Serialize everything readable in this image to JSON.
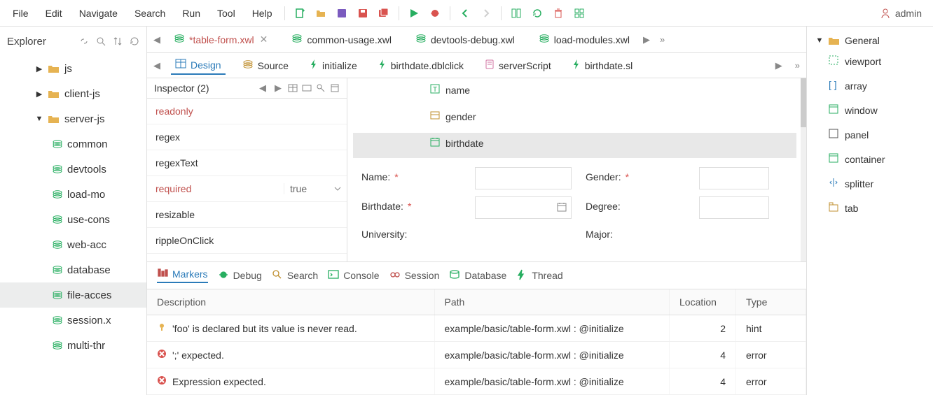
{
  "menu": {
    "file": "File",
    "edit": "Edit",
    "navigate": "Navigate",
    "search": "Search",
    "run": "Run",
    "tool": "Tool",
    "help": "Help"
  },
  "user": "admin",
  "explorer": {
    "title": "Explorer",
    "tree": [
      {
        "label": "js",
        "type": "folder",
        "depth": 1,
        "caret": "▶"
      },
      {
        "label": "client-js",
        "type": "folder",
        "depth": 1,
        "caret": "▶"
      },
      {
        "label": "server-js",
        "type": "folder",
        "depth": 1,
        "caret": "▼",
        "expanded": true
      },
      {
        "label": "common",
        "type": "file",
        "depth": 2
      },
      {
        "label": "devtools",
        "type": "file",
        "depth": 2
      },
      {
        "label": "load-mo",
        "type": "file",
        "depth": 2
      },
      {
        "label": "use-cons",
        "type": "file",
        "depth": 2
      },
      {
        "label": "web-acc",
        "type": "file",
        "depth": 2
      },
      {
        "label": "database",
        "type": "file",
        "depth": 2
      },
      {
        "label": "file-acces",
        "type": "file",
        "depth": 2,
        "selected": true
      },
      {
        "label": "session.x",
        "type": "file",
        "depth": 2
      },
      {
        "label": "multi-thr",
        "type": "file",
        "depth": 2
      }
    ]
  },
  "fileTabs": [
    {
      "label": "*table-form.xwl",
      "active": true,
      "closable": true
    },
    {
      "label": "common-usage.xwl"
    },
    {
      "label": "devtools-debug.xwl"
    },
    {
      "label": "load-modules.xwl"
    }
  ],
  "subTabs": [
    {
      "label": "Design",
      "icon": "grid",
      "active": true
    },
    {
      "label": "Source",
      "icon": "layers"
    },
    {
      "label": "initialize",
      "icon": "bolt"
    },
    {
      "label": "birthdate.dblclick",
      "icon": "bolt"
    },
    {
      "label": "serverScript",
      "icon": "script"
    },
    {
      "label": "birthdate.sl",
      "icon": "bolt"
    }
  ],
  "inspector": {
    "title": "Inspector (2)",
    "props": [
      {
        "name": "readonly",
        "hl": true
      },
      {
        "name": "regex"
      },
      {
        "name": "regexText"
      },
      {
        "name": "required",
        "hl": true,
        "value": "true"
      },
      {
        "name": "resizable"
      },
      {
        "name": "rippleOnClick"
      }
    ]
  },
  "canvas": {
    "rows": [
      {
        "label": "name",
        "icon": "text",
        "color": "#27ae60"
      },
      {
        "label": "gender",
        "icon": "form",
        "color": "#c09030"
      },
      {
        "label": "birthdate",
        "icon": "calendar",
        "color": "#27ae60",
        "selected": true
      }
    ],
    "form": {
      "name": "Name:",
      "gender": "Gender:",
      "birthdate": "Birthdate:",
      "degree": "Degree:",
      "university": "University:",
      "major": "Major:"
    }
  },
  "palette": {
    "header": "General",
    "items": [
      {
        "label": "viewport",
        "color": "#27ae60",
        "icon": "rect-dashed"
      },
      {
        "label": "array",
        "color": "#2b7bb9",
        "icon": "brackets"
      },
      {
        "label": "window",
        "color": "#27ae60",
        "icon": "window"
      },
      {
        "label": "panel",
        "color": "#555",
        "icon": "square"
      },
      {
        "label": "container",
        "color": "#27ae60",
        "icon": "window"
      },
      {
        "label": "splitter",
        "color": "#2b7bb9",
        "icon": "splitter"
      },
      {
        "label": "tab",
        "color": "#c09030",
        "icon": "tab"
      }
    ]
  },
  "south": {
    "tabs": [
      {
        "label": "Markers",
        "icon": "bars",
        "active": true
      },
      {
        "label": "Debug",
        "icon": "bug"
      },
      {
        "label": "Search",
        "icon": "search"
      },
      {
        "label": "Console",
        "icon": "console"
      },
      {
        "label": "Session",
        "icon": "session"
      },
      {
        "label": "Database",
        "icon": "db"
      },
      {
        "label": "Thread",
        "icon": "bolt"
      }
    ],
    "columns": {
      "desc": "Description",
      "path": "Path",
      "loc": "Location",
      "type": "Type"
    },
    "rows": [
      {
        "icon": "hint",
        "desc": "'foo' is declared but its value is never read.",
        "path": "example/basic/table-form.xwl : @initialize",
        "loc": "2",
        "type": "hint"
      },
      {
        "icon": "error",
        "desc": "';' expected.",
        "path": "example/basic/table-form.xwl : @initialize",
        "loc": "4",
        "type": "error"
      },
      {
        "icon": "error",
        "desc": "Expression expected.",
        "path": "example/basic/table-form.xwl : @initialize",
        "loc": "4",
        "type": "error"
      }
    ]
  }
}
